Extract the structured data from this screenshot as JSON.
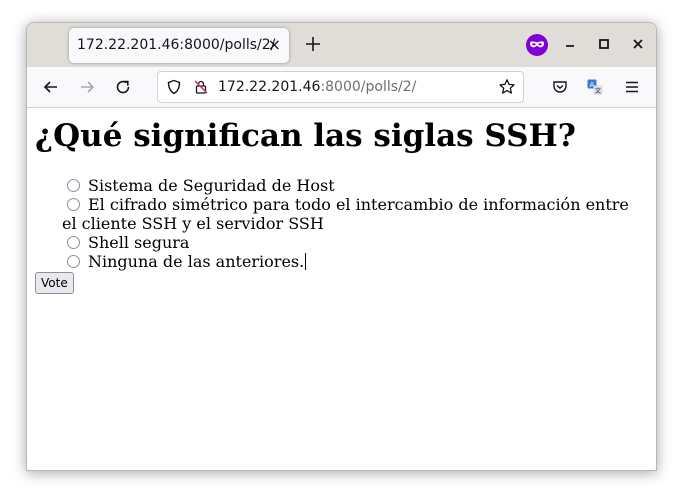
{
  "browser": {
    "tab": {
      "title": "172.22.201.46:8000/polls/2/",
      "close_glyph": "×"
    },
    "url": {
      "host": "172.22.201.46",
      "rest": ":8000/polls/2/"
    },
    "icons": {
      "new_tab": "plus-icon",
      "private_mask": "private-browsing-mask-icon",
      "minimize": "minimize-icon",
      "maximize": "maximize-icon",
      "close": "close-icon",
      "back": "arrow-left-icon",
      "forward": "arrow-right-icon",
      "reload": "reload-icon",
      "shield": "tracking-protection-shield-icon",
      "insecure_lock": "insecure-lock-icon",
      "bookmark": "star-icon",
      "pocket": "pocket-icon",
      "translate": "translate-icon",
      "menu": "hamburger-menu-icon"
    },
    "colors": {
      "accent_private": "#8000d7",
      "tabbar": "#e0ddd9",
      "navbar": "#f9f9fb"
    }
  },
  "poll": {
    "question": "¿Qué significan las siglas SSH?",
    "choices": [
      "Sistema de Seguridad de Host",
      "El cifrado simétrico para todo el intercambio de información entre el cliente SSH y el servidor SSH",
      "Shell segura",
      "Ninguna de las anteriores."
    ],
    "vote_label": "Vote"
  }
}
